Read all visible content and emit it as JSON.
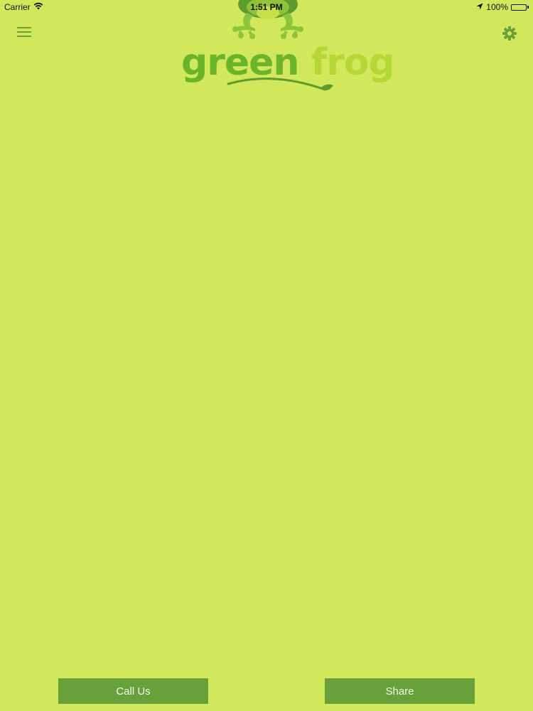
{
  "status_bar": {
    "carrier": "Carrier",
    "time": "1:51 PM",
    "battery": "100%",
    "icons": [
      "wifi-icon",
      "location-arrow-icon",
      "battery-icon"
    ]
  },
  "header": {
    "menu_icon": "hamburger-menu-icon",
    "settings_icon": "gear-icon",
    "logo": {
      "word1": "green",
      "word2": "frog"
    }
  },
  "footer": {
    "call_label": "Call Us",
    "share_label": "Share"
  },
  "colors": {
    "background": "#d1e85c",
    "button": "#67a13b",
    "button_text": "#f4f8e8",
    "icon": "#6a9f3a",
    "logo_dark": "#6ab42a",
    "logo_light": "#b6d836"
  }
}
